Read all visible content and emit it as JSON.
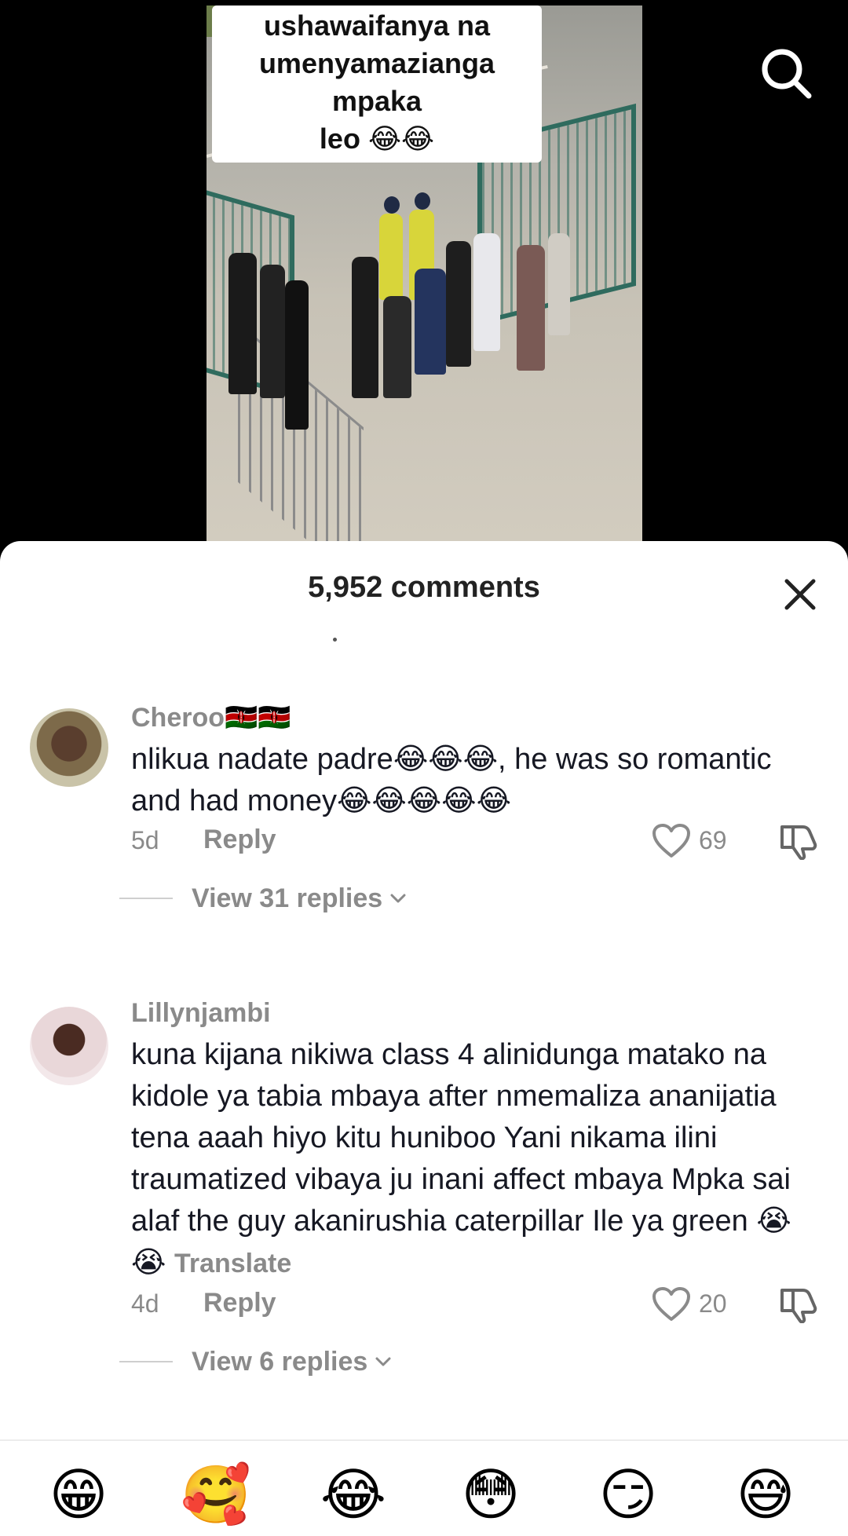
{
  "video": {
    "caption_line1": "ushawaifanya na",
    "caption_line2": "umenyamazianga mpaka",
    "caption_line3": "leo 😂😂"
  },
  "icons": {
    "search": "search-icon",
    "close": "close-icon",
    "like": "heart-icon",
    "dislike": "thumbs-down-icon",
    "chevron": "chevron-down-icon"
  },
  "comments_sheet": {
    "title": "5,952 comments",
    "comments": [
      {
        "username": "Cheroo🇰🇪🇰🇪",
        "text": "nlikua nadate padre😂😂😂, he was so romantic and had money😂😂😂😂😂",
        "time": "5d",
        "reply_label": "Reply",
        "likes": "69",
        "view_replies": "View 31 replies"
      },
      {
        "username": "Lillynjambi",
        "text": "kuna kijana nikiwa class 4 alinidunga matako na kidole ya tabia mbaya after nmemaliza ananijatia tena aaah hiyo kitu huniboo Yani nikama ilini traumatized vibaya ju inani affect mbaya Mpka sai alaf the guy akanirushia caterpillar Ile ya green 😭😭",
        "translate_label": "Translate",
        "time": "4d",
        "reply_label": "Reply",
        "likes": "20",
        "view_replies": "View 6 replies"
      }
    ]
  },
  "emoji_bar": [
    "😁",
    "🥰",
    "😂",
    "😳",
    "😏",
    "😅"
  ],
  "colors": {
    "sheet_bg": "#ffffff",
    "muted_text": "#8a8a8a",
    "primary_text": "#161823",
    "fence_green": "#2f6b5e"
  }
}
